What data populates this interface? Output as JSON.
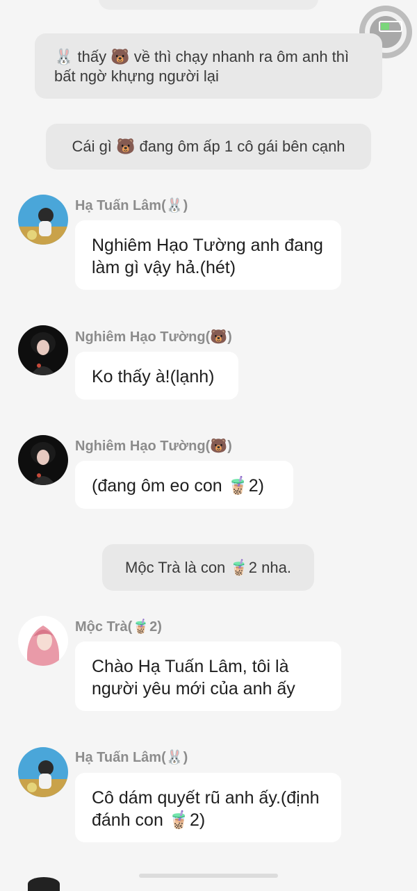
{
  "status_bar": {
    "battery_color": "#7bd67b"
  },
  "system_messages": [
    {
      "id": "s1",
      "text": "🐰 thấy 🐻 về thì chạy nhanh ra ôm anh thì bất ngờ khựng người lại"
    },
    {
      "id": "s2",
      "text": "Cái gì 🐻 đang ôm ấp 1 cô gái bên cạnh"
    },
    {
      "id": "s3",
      "text": "Mộc Trà là con 🧋2 nha."
    }
  ],
  "messages": [
    {
      "sender": "Hạ Tuấn Lâm(🐰)",
      "text": "Nghiêm Hạo Tường anh đang làm gì vậy hả.(hét)",
      "avatar": "avatar-boy-blue"
    },
    {
      "sender": "Nghiêm Hạo Tường(🐻)",
      "text": "Ko thấy à!(lạnh)",
      "avatar": "avatar-dark"
    },
    {
      "sender": "Nghiêm Hạo Tường(🐻)",
      "text": "(đang ôm eo con 🧋2)",
      "avatar": "avatar-dark"
    },
    {
      "sender": "Mộc Trà(🧋2)",
      "text": "Chào Hạ Tuấn Lâm, tôi là người yêu mới của anh ấy",
      "avatar": "avatar-pink-girl"
    },
    {
      "sender": "Hạ Tuấn Lâm(🐰)",
      "text": "Cô dám quyết rũ anh ấy.(định đánh con 🧋2)",
      "avatar": "avatar-boy-blue"
    }
  ]
}
